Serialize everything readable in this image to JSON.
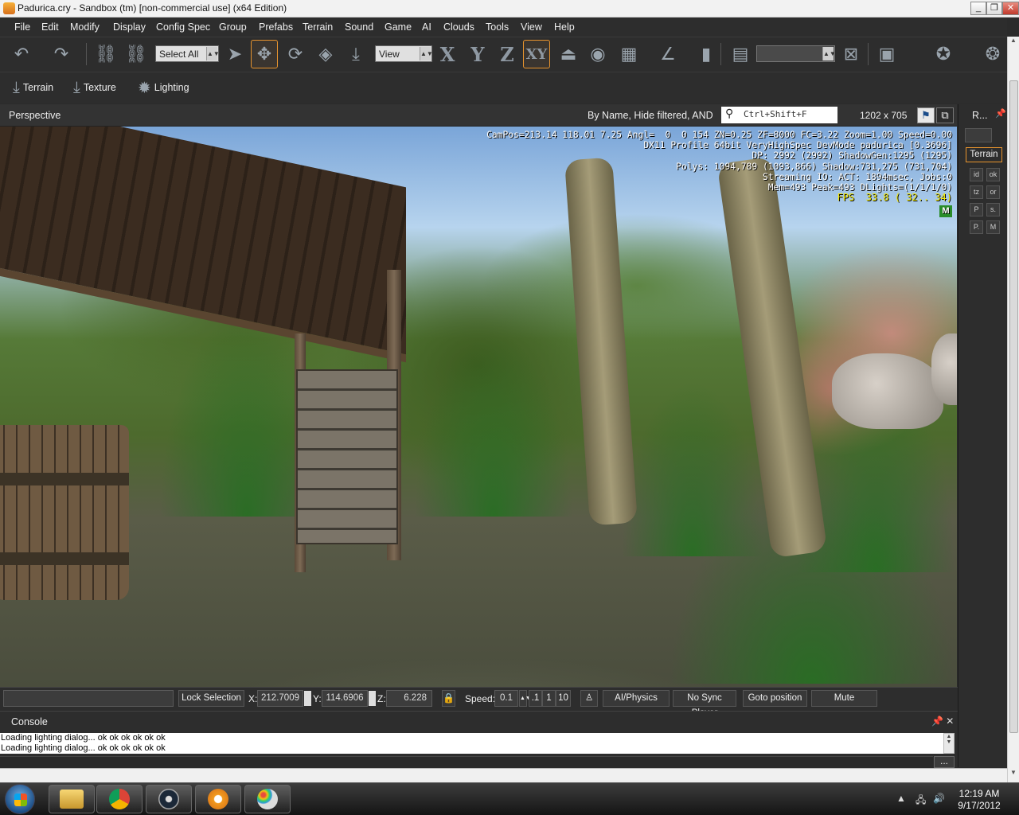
{
  "window": {
    "title": "Padurica.cry - Sandbox (tm) [non-commercial use] (x64 Edition)",
    "buttons": {
      "minimize": "_",
      "maximize": "❐",
      "close": "✕"
    }
  },
  "menu": [
    "File",
    "Edit",
    "Modify",
    "Display",
    "Config Spec",
    "Group",
    "Prefabs",
    "Terrain",
    "Sound",
    "Game",
    "AI",
    "Clouds",
    "Tools",
    "View",
    "Help"
  ],
  "toolbar": {
    "select_combo": "Select All",
    "view_combo": "View",
    "axis_x": "X",
    "axis_y": "Y",
    "axis_z": "Z",
    "axis_xy": "XY",
    "empty_combo": "",
    "icons": [
      "undo-icon",
      "redo-icon",
      "link-icon",
      "unlink-icon",
      "select-arrow-icon",
      "move-icon",
      "rotate-icon",
      "scale-icon",
      "snap-to-terrain-icon",
      "terrain-snap-icon",
      "camera-icon",
      "grid-icon",
      "angle-snap-icon",
      "ruler-icon",
      "layer-icon",
      "physics-icon",
      "save-level-icon",
      "globe-icon"
    ]
  },
  "toolbar2": {
    "terrain": "Terrain",
    "texture": "Texture",
    "lighting": "Lighting"
  },
  "viewport": {
    "label": "Perspective",
    "filter_text": "By Name, Hide filtered, AND",
    "search_placeholder": "Ctrl+Shift+F",
    "resolution": "1202 x 705",
    "hud": {
      "line1": "CamPos=213.14 118.01 7.25 Angl=  0  0 154 ZN=0.25 ZF=8000 FC=3.22 Zoom=1.00 Speed=0.00",
      "line2": "DX11 Profile 64bit VeryHighSpec DevMode padurica [0.3696]",
      "line3": "DP: 2992 (2992) ShadowGen:1295 (1295)",
      "line4": "Polys: 1094,789 (1093,866) Shadow:731,275 (731,704)",
      "line5": "Streaming IO: ACT: 1894msec, Jobs:0",
      "line6": "Mem=493 Peak=493 DLights=(1/1/1/0)",
      "fps": "FPS  33.8 ( 32.. 34)",
      "badge": "M"
    }
  },
  "right_panel": {
    "header": "R...",
    "tab": "Terrain",
    "tools": [
      "id",
      "ok",
      "tz",
      "or",
      "P",
      "s.",
      "P.",
      "M"
    ]
  },
  "status": {
    "lock_selection": "Lock Selection",
    "x_label": "X:",
    "x_value": "212.7009",
    "y_label": "Y:",
    "y_value": "114.6906",
    "z_label": "Z:",
    "z_value": "6.228",
    "speed_label": "Speed:",
    "speed_value": "0.1",
    "speed_01": ".1",
    "speed_1": "1",
    "speed_10": "10",
    "ai_physics": "AI/Physics",
    "no_sync_player": "No Sync Player",
    "goto_position": "Goto position",
    "mute": "Mute"
  },
  "console": {
    "title": "Console",
    "lines": [
      "Loading lighting dialog... ok ok ok ok ok ok",
      "Loading lighting dialog... ok ok ok ok ok ok"
    ],
    "more": "..."
  },
  "taskbar": {
    "apps": [
      "explorer",
      "chrome",
      "steam",
      "sandbox",
      "paint"
    ],
    "time": "12:19 AM",
    "date": "9/17/2012"
  }
}
